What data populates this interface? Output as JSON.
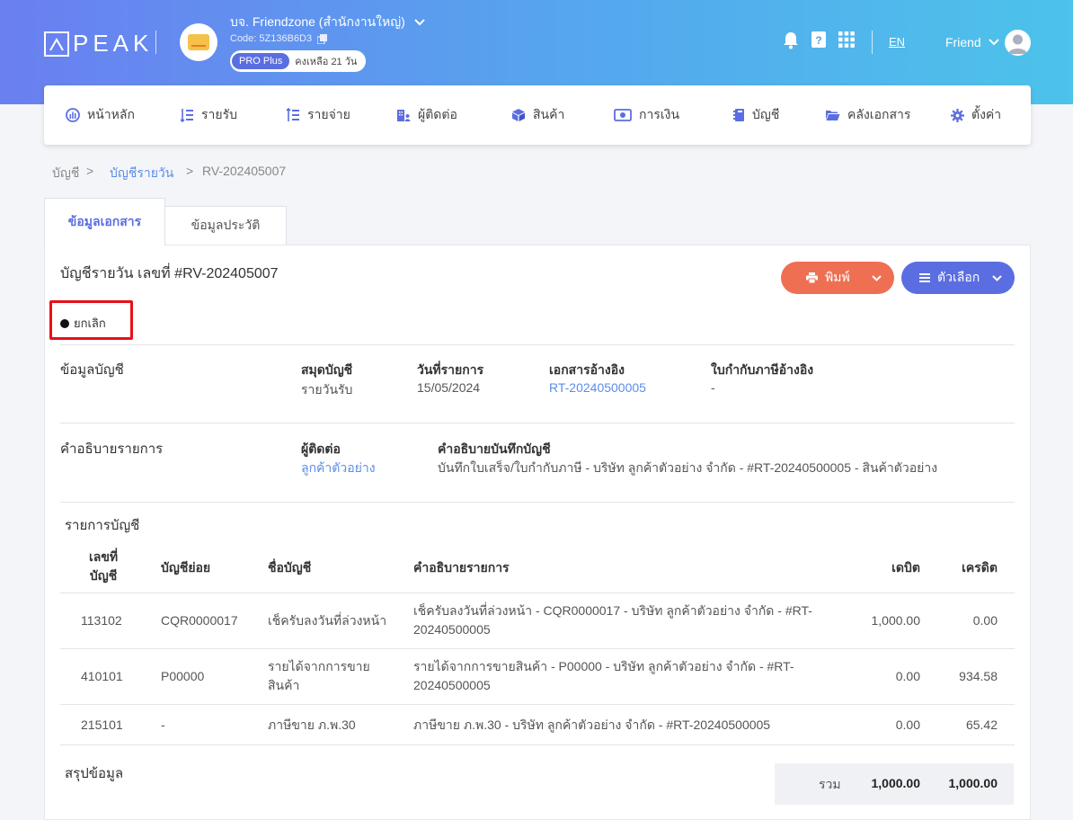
{
  "header": {
    "logo_text": "PEAK",
    "org_name": "บจ. Friendzone (สำนักงานใหญ่)",
    "org_code": "Code: 5Z136B6D3",
    "plan_label": "PRO Plus",
    "plan_remaining": "คงเหลือ 21 วัน",
    "language": "EN",
    "user_name": "Friend"
  },
  "nav": {
    "items": [
      {
        "label": "หน้าหลัก",
        "icon": "dashboard-icon"
      },
      {
        "label": "รายรับ",
        "icon": "income-icon"
      },
      {
        "label": "รายจ่าย",
        "icon": "expense-icon"
      },
      {
        "label": "ผู้ติดต่อ",
        "icon": "contacts-icon"
      },
      {
        "label": "สินค้า",
        "icon": "box-icon"
      },
      {
        "label": "การเงิน",
        "icon": "money-icon"
      },
      {
        "label": "บัญชี",
        "icon": "ledger-icon"
      },
      {
        "label": "คลังเอกสาร",
        "icon": "folder-icon"
      },
      {
        "label": "ตั้งค่า",
        "icon": "gear-icon"
      }
    ]
  },
  "breadcrumb": {
    "root": "บัญชี",
    "sep": ">",
    "parent": "บัญชีรายวัน",
    "current": "RV-202405007"
  },
  "tabs": {
    "doc_info": "ข้อมูลเอกสาร",
    "history": "ข้อมูลประวัติ"
  },
  "document": {
    "title": "บัญชีรายวัน เลขที่ #RV-202405007",
    "status": "ยกเลิก",
    "print_label": "พิมพ์",
    "options_label": "ตัวเลือก"
  },
  "account_info": {
    "section_title": "ข้อมูลบัญชี",
    "journal_label": "สมุดบัญชี",
    "journal_value": "รายวันรับ",
    "date_label": "วันที่รายการ",
    "date_value": "15/05/2024",
    "ref_doc_label": "เอกสารอ้างอิง",
    "ref_doc_value": "RT-20240500005",
    "tax_ref_label": "ใบกำกับภาษีอ้างอิง",
    "tax_ref_value": "-"
  },
  "description": {
    "section_title": "คำอธิบายรายการ",
    "contact_label": "ผู้ติดต่อ",
    "contact_value": "ลูกค้าตัวอย่าง",
    "note_label": "คำอธิบายบันทึกบัญชี",
    "note_value": "บันทึกใบเสร็จ/ใบกำกับภาษี - บริษัท ลูกค้าตัวอย่าง จำกัด - #RT-20240500005 - สินค้าตัวอย่าง"
  },
  "entries": {
    "section_title": "รายการบัญชี",
    "headers": {
      "code_line1": "เลขที่",
      "code_line2": "บัญชี",
      "sub": "บัญชีย่อย",
      "name": "ชื่อบัญชี",
      "desc": "คำอธิบายรายการ",
      "debit": "เดบิต",
      "credit": "เครดิต"
    },
    "rows": [
      {
        "code": "113102",
        "sub": "CQR0000017",
        "name": "เช็ครับลงวันที่ล่วงหน้า",
        "desc1": "เช็ครับลงวันที่ล่วงหน้า - CQR0000017 - บริษัท ลูกค้าตัวอย่าง จำกัด - #RT-",
        "desc2": "20240500005",
        "debit": "1,000.00",
        "credit": "0.00"
      },
      {
        "code": "410101",
        "sub": "P00000",
        "name": "รายได้จากการขาย",
        "name2": "สินค้า",
        "desc1": "รายได้จากการขายสินค้า - P00000 - บริษัท ลูกค้าตัวอย่าง จำกัด - #RT-",
        "desc2": "20240500005",
        "debit": "0.00",
        "credit": "934.58"
      },
      {
        "code": "215101",
        "sub": "-",
        "name": "ภาษีขาย ภ.พ.30",
        "desc1": "ภาษีขาย ภ.พ.30 - บริษัท ลูกค้าตัวอย่าง จำกัด - #RT-20240500005",
        "debit": "0.00",
        "credit": "65.42"
      }
    ]
  },
  "summary": {
    "section_title": "สรุปข้อมูล",
    "total_label": "รวม",
    "total_debit": "1,000.00",
    "total_credit": "1,000.00"
  }
}
